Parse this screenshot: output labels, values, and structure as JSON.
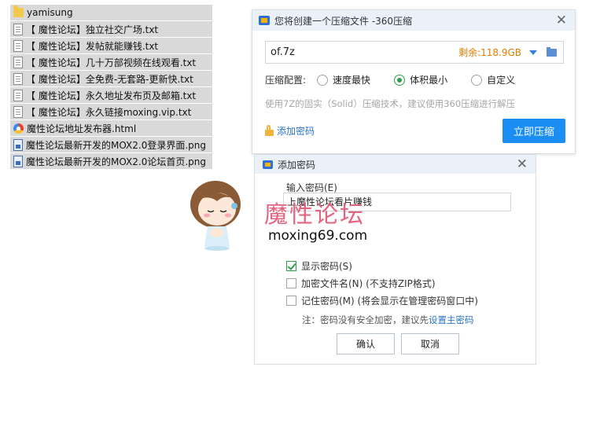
{
  "files": [
    {
      "name": "yamisung",
      "type": "folder"
    },
    {
      "name": "【 魔性论坛】独立社交广场.txt",
      "type": "txt"
    },
    {
      "name": "【 魔性论坛】发帖就能赚钱.txt",
      "type": "txt"
    },
    {
      "name": "【 魔性论坛】几十万部视频在线观看.txt",
      "type": "txt"
    },
    {
      "name": "【 魔性论坛】全免费-无套路-更新快.txt",
      "type": "txt"
    },
    {
      "name": "【 魔性论坛】永久地址发布页及邮箱.txt",
      "type": "txt"
    },
    {
      "name": "【 魔性论坛】永久链接moxing.vip.txt",
      "type": "txt"
    },
    {
      "name": "魔性论坛地址发布器.html",
      "type": "html"
    },
    {
      "name": "魔性论坛最新开发的MOX2.0登录界面.png",
      "type": "png"
    },
    {
      "name": "魔性论坛最新开发的MOX2.0论坛首页.png",
      "type": "png"
    }
  ],
  "compress_dialog": {
    "title": "您将创建一个压缩文件 -360压缩",
    "path_value": "of.7z",
    "free_space": "剩余:118.9GB",
    "config_label": "压缩配置:",
    "options": [
      {
        "label": "速度最快",
        "selected": false
      },
      {
        "label": "体积最小",
        "selected": true
      },
      {
        "label": "自定义",
        "selected": false
      }
    ],
    "hint": "使用7Z的固实（Solid）压缩技术，建议使用360压缩进行解压",
    "add_password_link": "添加密码",
    "compress_button": "立即压缩"
  },
  "password_dialog": {
    "title": "添加密码",
    "input_label": "输入密码(E)",
    "input_value": "上魔性论坛看片赚钱",
    "checkboxes": [
      {
        "label": "显示密码(S)",
        "checked": true
      },
      {
        "label": "加密文件名(N) (不支持ZIP格式)",
        "checked": false
      },
      {
        "label": "记住密码(M) (将会显示在管理密码窗口中)",
        "checked": false
      }
    ],
    "note_prefix": "注：密码没有安全加密，建议先",
    "note_link": "设置主密码",
    "ok_button": "确认",
    "cancel_button": "取消"
  },
  "watermark": {
    "text": "魔性论坛",
    "url": "moxing69.com"
  },
  "colors": {
    "accent": "#1a8ef2",
    "free_space": "#e07c00",
    "watermark": "#e25876",
    "selection": "#2c9f4b"
  }
}
